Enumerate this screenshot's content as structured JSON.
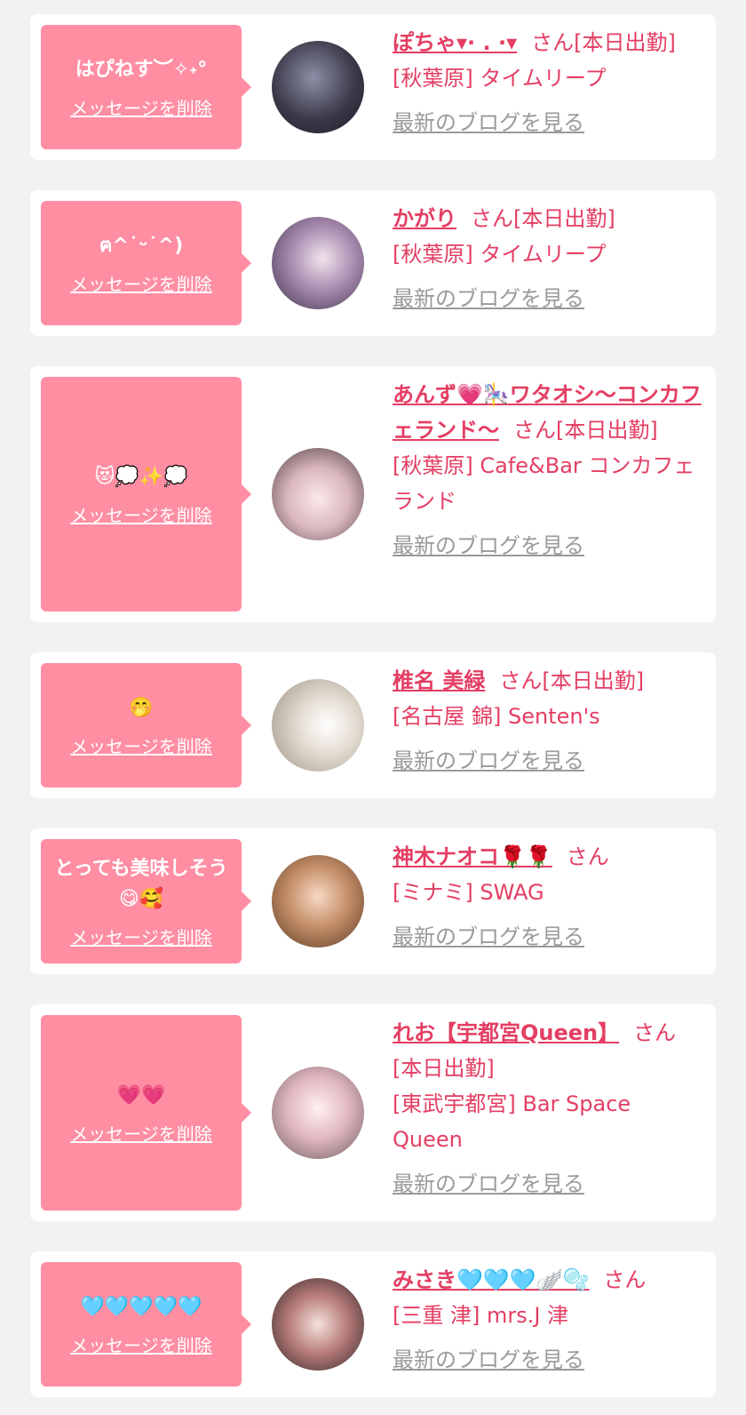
{
  "messages": [
    {
      "bubble_text": "はぴねす︶✧˖°",
      "delete_label": "メッセージを削除",
      "cast_name": "ぽちゃ▾· . ·▾",
      "suffix": "さん",
      "status": "[本日出勤]",
      "location": "[秋葉原] タイムリープ",
      "blog_label": "最新のブログを見る"
    },
    {
      "bubble_text": "ฅ^˙ᵕ˙^)",
      "delete_label": "メッセージを削除",
      "cast_name": "かがり",
      "suffix": "さん",
      "status": "[本日出勤]",
      "location": "[秋葉原] タイムリープ",
      "blog_label": "最新のブログを見る"
    },
    {
      "bubble_text": "😻💭✨💭",
      "delete_label": "メッセージを削除",
      "cast_name": "あんず💗🎠ワタオシ〜コンカフェランド〜",
      "suffix": "さん",
      "status": "[本日出勤]",
      "location": "[秋葉原] Cafe&Bar コンカフェランド",
      "blog_label": "最新のブログを見る"
    },
    {
      "bubble_text": "🤭",
      "delete_label": "メッセージを削除",
      "cast_name": "椎名 美緑",
      "suffix": "さん",
      "status": "[本日出勤]",
      "location": "[名古屋 錦] Senten's",
      "blog_label": "最新のブログを見る"
    },
    {
      "bubble_text": "とっても美味しそう😋🥰",
      "delete_label": "メッセージを削除",
      "cast_name": "神木ナオコ🌹🌹",
      "suffix": "さん",
      "status": "",
      "location": "[ミナミ] SWAG",
      "blog_label": "最新のブログを見る"
    },
    {
      "bubble_text": "💗💗",
      "delete_label": "メッセージを削除",
      "cast_name": "れお【宇都宮Queen】",
      "suffix": "さん",
      "status": "[本日出勤]",
      "location": "[東武宇都宮] Bar Space Queen",
      "blog_label": "最新のブログを見る"
    },
    {
      "bubble_text": "🩵🩵🩵🩵🩵",
      "delete_label": "メッセージを削除",
      "cast_name": "みさき🩵🩵🩵🪽🫧",
      "suffix": "さん",
      "status": "",
      "location": "[三重 津] mrs.J 津",
      "blog_label": "最新のブログを見る"
    }
  ],
  "colors": {
    "page_background": "#f2f2f2",
    "card_background": "#ffffff",
    "bubble_background": "#ff8ea3",
    "accent_text": "#e43e63",
    "link_gray": "#9a9a9a"
  },
  "icons": [
    "avatar-photo"
  ]
}
